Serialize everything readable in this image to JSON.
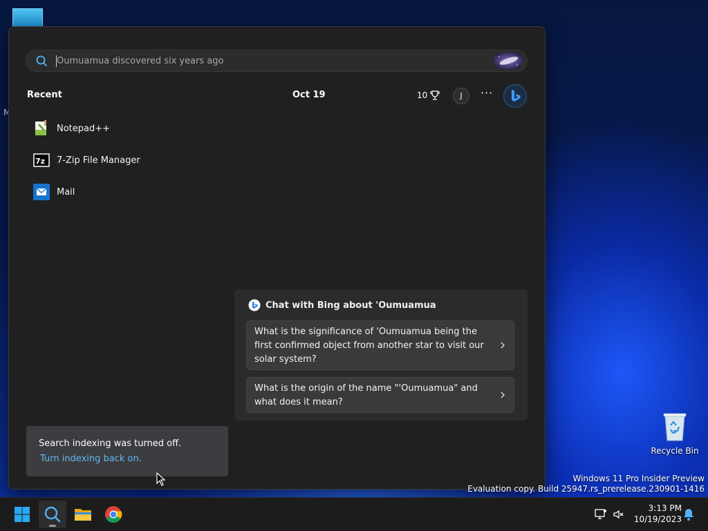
{
  "search": {
    "value": "",
    "placeholder": "Oumuamua discovered six years ago"
  },
  "header": {
    "recent_label": "Recent",
    "date": "Oct 19",
    "reward_points": "10",
    "avatar_initial": "J",
    "more_label": "···"
  },
  "recent": [
    {
      "label": "Notepad++",
      "icon": "notepad-plus-plus-icon"
    },
    {
      "label": "7-Zip File Manager",
      "icon": "seven-zip-icon"
    },
    {
      "label": "Mail",
      "icon": "mail-icon"
    }
  ],
  "bing_chat": {
    "title": "Chat with Bing about 'Oumuamua",
    "suggestions": [
      "What is the significance of 'Oumuamua being the first confirmed object from another star to visit our solar system?",
      "What is the origin of the name \"'Oumuamua\" and what does it mean?"
    ]
  },
  "indexing": {
    "message": "Search indexing was turned off.",
    "link": "Turn indexing back on."
  },
  "desktop": {
    "partial_label": "M",
    "recycle_bin_label": "Recycle Bin",
    "watermark_line1": "Windows 11 Pro Insider Preview",
    "watermark_line2": "Evaluation copy. Build 25947.rs_prerelease.230901-1416"
  },
  "taskbar": {
    "time": "3:13 PM",
    "date": "10/19/2023"
  },
  "colors": {
    "accent_link": "#63b9f3",
    "panel_bg": "#202020",
    "taskbar_bg": "#1c1c1c"
  }
}
